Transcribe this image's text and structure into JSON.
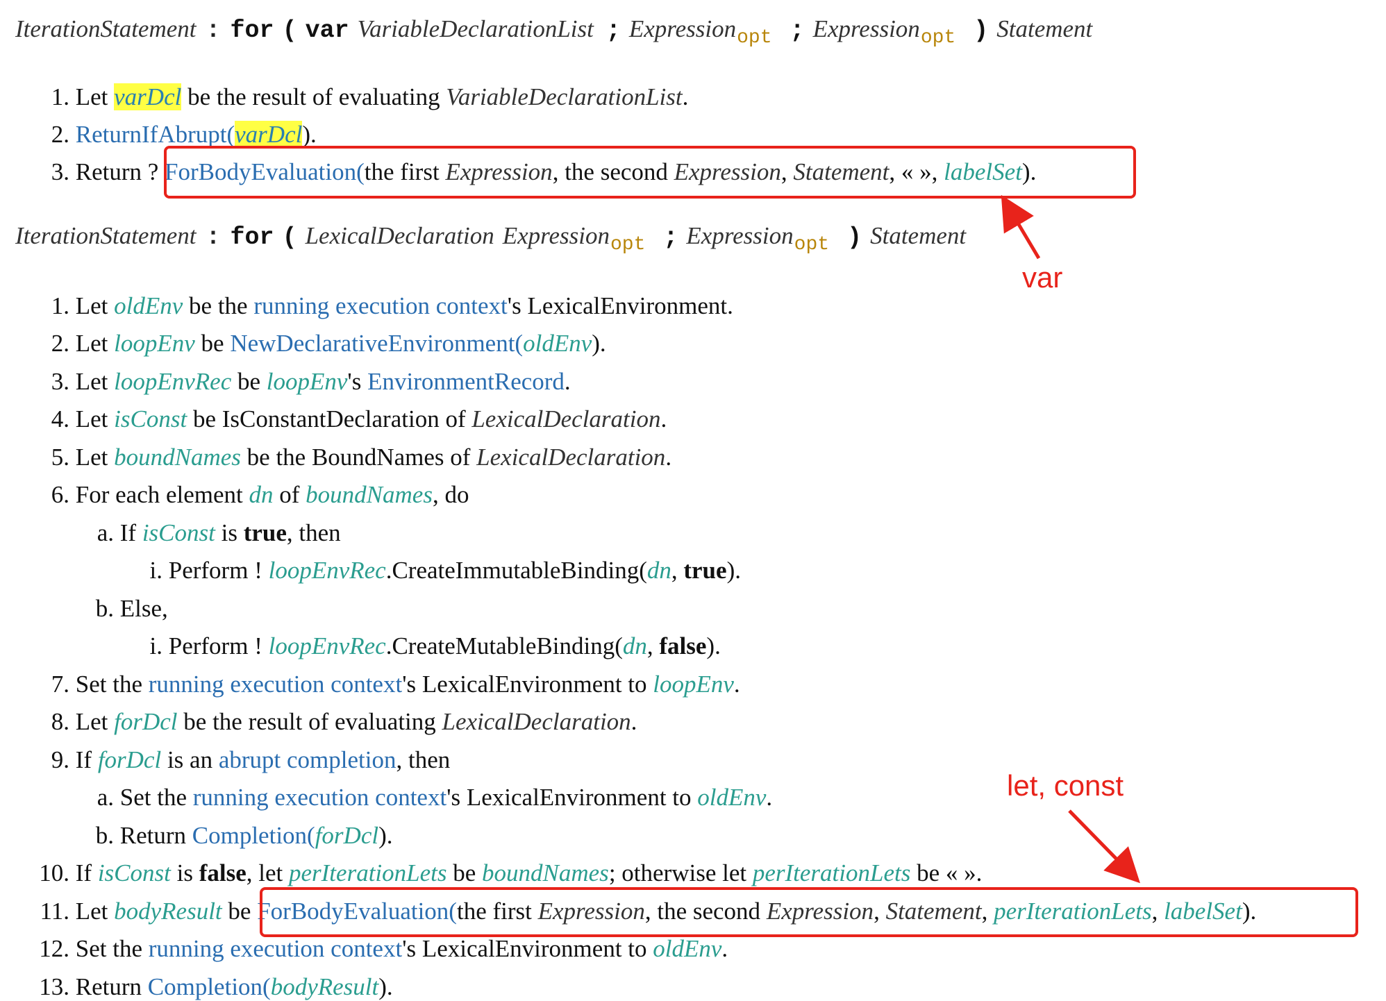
{
  "production1": {
    "lhs": "IterationStatement",
    "colon": ":",
    "kw_for": "for",
    "lparen": "(",
    "kw_var": "var",
    "nt_vdl": "VariableDeclarationList",
    "semi1": ";",
    "nt_expr1": "Expression",
    "opt1": "opt",
    "semi2": ";",
    "nt_expr2": "Expression",
    "opt2": "opt",
    "rparen": ")",
    "nt_stmt": "Statement"
  },
  "steps1": [
    {
      "num": "1.",
      "t1": "Let ",
      "v1": "varDcl",
      "t2": " be the result of evaluating ",
      "i1": "VariableDeclarationList",
      "t3": "."
    },
    {
      "num": "2.",
      "a1": "ReturnIfAbrupt(",
      "v1": "varDcl",
      "t1": ")."
    },
    {
      "num": "3.",
      "t1": "Return ? ",
      "a1": "ForBodyEvaluation(",
      "t2": "the first ",
      "i1": "Expression",
      "t3": ", the second ",
      "i2": "Expression",
      "t4": ", ",
      "i3": "Statement",
      "t5": ", « », ",
      "v1": "labelSet",
      "t6": ")."
    }
  ],
  "production2": {
    "lhs": "IterationStatement",
    "colon": ":",
    "kw_for": "for",
    "lparen": "(",
    "nt_lexdecl": "LexicalDeclaration",
    "nt_expr1": "Expression",
    "opt1": "opt",
    "semi": ";",
    "nt_expr2": "Expression",
    "opt2": "opt",
    "rparen": ")",
    "nt_stmt": "Statement"
  },
  "annotations": {
    "var_label": "var",
    "letconst_label": "let, const",
    "color": "#e8231b"
  },
  "steps2": {
    "s1": {
      "num": "1.",
      "t1": "Let ",
      "v1": "oldEnv",
      "t2": " be the ",
      "a1": "running execution context",
      "t3": "'s LexicalEnvironment."
    },
    "s2": {
      "num": "2.",
      "t1": "Let ",
      "v1": "loopEnv",
      "t2": " be ",
      "a1": "NewDeclarativeEnvironment(",
      "v2": "oldEnv",
      "t3": ")."
    },
    "s3": {
      "num": "3.",
      "t1": "Let ",
      "v1": "loopEnvRec",
      "t2": " be ",
      "v2": "loopEnv",
      "t3": "'s ",
      "a1": "EnvironmentRecord",
      "t4": "."
    },
    "s4": {
      "num": "4.",
      "t1": "Let ",
      "v1": "isConst",
      "t2": " be IsConstantDeclaration of ",
      "i1": "LexicalDeclaration",
      "t3": "."
    },
    "s5": {
      "num": "5.",
      "t1": "Let ",
      "v1": "boundNames",
      "t2": " be the BoundNames of ",
      "i1": "LexicalDeclaration",
      "t3": "."
    },
    "s6": {
      "num": "6.",
      "t1": "For each element ",
      "v1": "dn",
      "t2": " of ",
      "v2": "boundNames",
      "t3": ", do"
    },
    "s6a": {
      "num": "a.",
      "t1": "If ",
      "v1": "isConst",
      "t2": " is ",
      "b1": "true",
      "t3": ", then"
    },
    "s6ai": {
      "num": "i.",
      "t1": "Perform ! ",
      "v1": "loopEnvRec",
      "t2": ".CreateImmutableBinding(",
      "v2": "dn",
      "t3": ", ",
      "b1": "true",
      "t4": ")."
    },
    "s6b": {
      "num": "b.",
      "t1": "Else,"
    },
    "s6bi": {
      "num": "i.",
      "t1": "Perform ! ",
      "v1": "loopEnvRec",
      "t2": ".CreateMutableBinding(",
      "v2": "dn",
      "t3": ", ",
      "b1": "false",
      "t4": ")."
    },
    "s7": {
      "num": "7.",
      "t1": "Set the ",
      "a1": "running execution context",
      "t2": "'s LexicalEnvironment to ",
      "v1": "loopEnv",
      "t3": "."
    },
    "s8": {
      "num": "8.",
      "t1": "Let ",
      "v1": "forDcl",
      "t2": " be the result of evaluating ",
      "i1": "LexicalDeclaration",
      "t3": "."
    },
    "s9": {
      "num": "9.",
      "t1": "If ",
      "v1": "forDcl",
      "t2": " is an ",
      "a1": "abrupt completion",
      "t3": ", then"
    },
    "s9a": {
      "num": "a.",
      "t1": "Set the ",
      "a1": "running execution context",
      "t2": "'s LexicalEnvironment to ",
      "v1": "oldEnv",
      "t3": "."
    },
    "s9b": {
      "num": "b.",
      "t1": "Return ",
      "a1": "Completion(",
      "v1": "forDcl",
      "t2": ")."
    },
    "s10": {
      "num": "10.",
      "t1": "If ",
      "v1": "isConst",
      "t2": " is ",
      "b1": "false",
      "t3": ", let ",
      "v2": "perIterationLets",
      "t4": " be ",
      "v3": "boundNames",
      "t5": "; otherwise let ",
      "v4": "perIterationLets",
      "t6": " be « »."
    },
    "s11": {
      "num": "11.",
      "t1": "Let ",
      "v1": "bodyResult",
      "t2": " be ",
      "a1": "ForBodyEvaluation(",
      "t3": "the first ",
      "i1": "Expression",
      "t4": ", the second ",
      "i2": "Expression",
      "t5": ", ",
      "i3": "Statement",
      "t6": ", ",
      "v2": "perIterationLets",
      "t7": ", ",
      "v3": "labelSet",
      "t8": ")."
    },
    "s12": {
      "num": "12.",
      "t1": "Set the ",
      "a1": "running execution context",
      "t2": "'s LexicalEnvironment to ",
      "v1": "oldEnv",
      "t3": "."
    },
    "s13": {
      "num": "13.",
      "t1": "Return ",
      "a1": "Completion(",
      "v1": "bodyResult",
      "t2": ")."
    }
  }
}
